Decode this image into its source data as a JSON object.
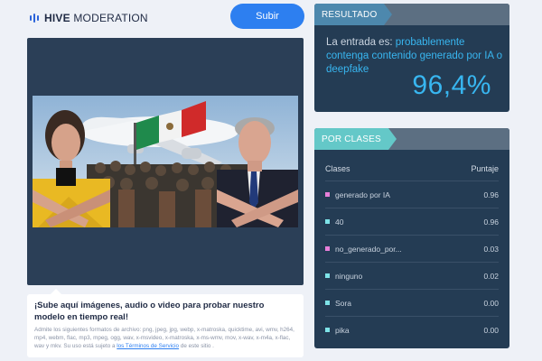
{
  "header": {
    "logo_bold": "HIVE",
    "logo_light": "MODERATION",
    "upload_label": "Subir"
  },
  "hint": {
    "title": "¡Sube aquí imágenes, audio o video para probar nuestro modelo en tiempo real!",
    "formats_prefix": "Admite los siguientes formatos de archivo: png, jpeg, jpg, webp, x-matroska, quicktime, avi, wmv, h264, mp4, webm, flac, mp3, mpeg, ogg, wav, x-msvideo, x-matroska, x-ms-wmv, mov, x-wav, x-m4a, x-flac, wav y mkv. Su uso está sujeto a",
    "terms_link": "los Términos de Servicio",
    "formats_suffix": "de este sitio ."
  },
  "result": {
    "tag": "RESULTADO",
    "prefix": "La entrada es:",
    "verdict": "probablemente contenga contenido generado por IA o deepfake",
    "percent": "96,4%"
  },
  "classes": {
    "tag": "POR CLASES",
    "col_class": "Clases",
    "col_score": "Puntaje",
    "rows": [
      {
        "label": "generado por IA",
        "score": "0.96",
        "color": "#e77fd9"
      },
      {
        "label": "40",
        "score": "0.96",
        "color": "#7ee3e8"
      },
      {
        "label": "no_generado_por...",
        "score": "0.03",
        "color": "#e77fd9"
      },
      {
        "label": "ninguno",
        "score": "0.02",
        "color": "#7ee3e8"
      },
      {
        "label": "Sora",
        "score": "0.00",
        "color": "#7ee3e8"
      },
      {
        "label": "pika",
        "score": "0.00",
        "color": "#7ee3e8"
      }
    ]
  },
  "colors": {
    "accent": "#2d7ff0",
    "highlight": "#38b6f0",
    "panel": "#243c54",
    "teal_tag": "#64c8c8"
  }
}
